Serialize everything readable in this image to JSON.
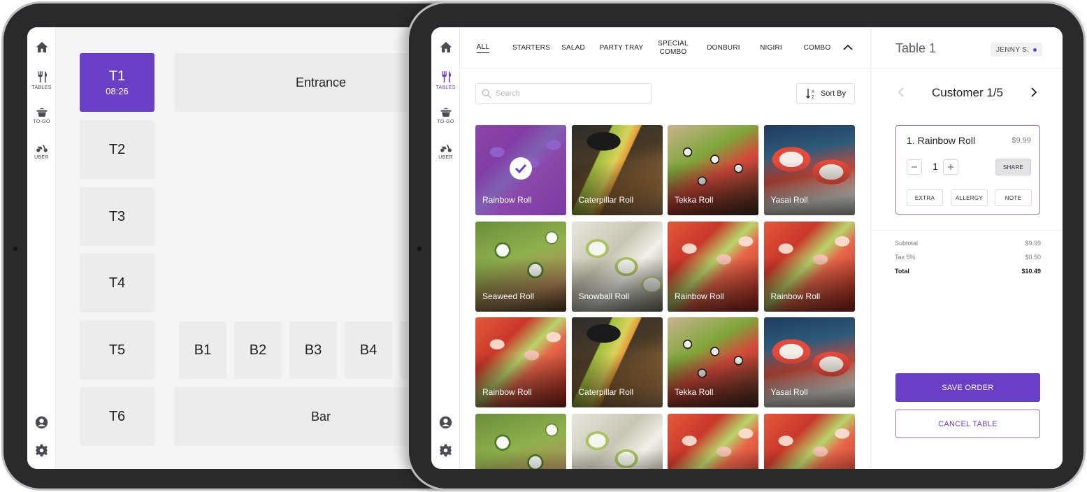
{
  "sidebar": {
    "items": [
      {
        "icon": "home-icon",
        "label": ""
      },
      {
        "icon": "utensils-icon",
        "label": "TABLES"
      },
      {
        "icon": "takeout-icon",
        "label": "TO-GO"
      },
      {
        "icon": "scooter-icon",
        "label": "UBER"
      }
    ],
    "bottom": [
      {
        "icon": "user-icon"
      },
      {
        "icon": "gear-icon"
      }
    ]
  },
  "floor_plan": {
    "tables": [
      {
        "name": "T1",
        "time": "08:26",
        "active": true
      },
      {
        "name": "T2"
      },
      {
        "name": "T3"
      },
      {
        "name": "T4"
      },
      {
        "name": "T5"
      },
      {
        "name": "T6"
      }
    ],
    "booths": [
      "B1",
      "B2",
      "B3",
      "B4"
    ],
    "areas": {
      "entrance": "Entrance",
      "bar": "Bar"
    }
  },
  "categories": [
    {
      "label": "ALL",
      "active": true
    },
    {
      "label": "STARTERS"
    },
    {
      "label": "SALAD"
    },
    {
      "label": "PARTY TRAY"
    },
    {
      "label": "SPECIAL COMBO"
    },
    {
      "label": "DONBURI"
    },
    {
      "label": "NIGIRI"
    },
    {
      "label": "COMBO"
    }
  ],
  "search": {
    "placeholder": "Search"
  },
  "sort": {
    "label": "Sort By"
  },
  "menu_items": [
    {
      "name": "Rainbow Roll",
      "img": "rainbow",
      "selected": true
    },
    {
      "name": "Caterpillar Roll",
      "img": "caterpillar"
    },
    {
      "name": "Tekka Roll",
      "img": "tekka"
    },
    {
      "name": "Yasai Roll",
      "img": "yasai"
    },
    {
      "name": "Seaweed Roll",
      "img": "seaweed"
    },
    {
      "name": "Snowball Roll",
      "img": "snowball"
    },
    {
      "name": "Rainbow Roll",
      "img": "rainbow"
    },
    {
      "name": "Rainbow Roll",
      "img": "rainbow"
    },
    {
      "name": "Rainbow Roll",
      "img": "rainbow"
    },
    {
      "name": "Caterpillar Roll",
      "img": "caterpillar"
    },
    {
      "name": "Tekka Roll",
      "img": "tekka"
    },
    {
      "name": "Yasai Roll",
      "img": "yasai"
    },
    {
      "name": "",
      "img": "seaweed"
    },
    {
      "name": "",
      "img": "snowball"
    },
    {
      "name": "",
      "img": "rainbow"
    },
    {
      "name": "",
      "img": "rainbow"
    }
  ],
  "order": {
    "table": "Table 1",
    "server": "JENNY S.",
    "customer": "Customer 1/5",
    "item": {
      "name": "1. Rainbow Roll",
      "price": "$9.99",
      "qty": "1"
    },
    "buttons": {
      "share": "SHARE",
      "extra": "EXTRA",
      "allergy": "ALLERGY",
      "note": "NOTE"
    },
    "totals": {
      "subtotal_label": "Subtotal",
      "subtotal": "$9.99",
      "tax_label": "Tax 5%",
      "tax": "$0.50",
      "total_label": "Total",
      "total": "$10.49"
    },
    "save_label": "SAVE ORDER",
    "cancel_label": "CANCEL TABLE"
  },
  "colors": {
    "accent": "#6a3fc5",
    "tile": "#ececee"
  }
}
